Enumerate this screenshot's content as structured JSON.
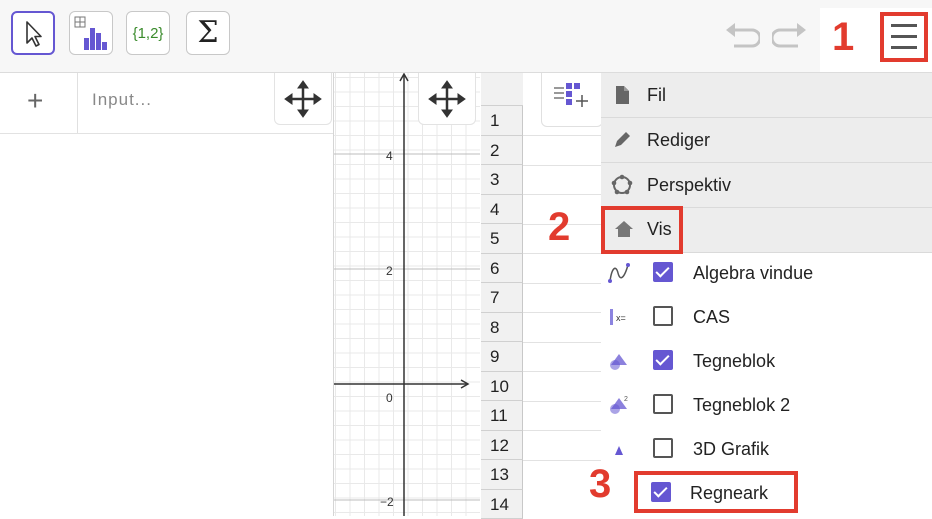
{
  "toolbar": {
    "tools": [
      {
        "name": "move-tool",
        "selected": true
      },
      {
        "name": "chart-tool",
        "selected": false
      },
      {
        "name": "list-tool",
        "label": "{1,2}",
        "selected": false
      },
      {
        "name": "sum-tool",
        "label": "Σ",
        "selected": false
      }
    ],
    "undo_icon": "undo-icon",
    "redo_icon": "redo-icon",
    "menu_icon": "hamburger-menu-icon"
  },
  "annotations": {
    "step1": "1",
    "step2": "2",
    "step3": "3",
    "highlight_color": "#e23b2e"
  },
  "algebra": {
    "add_symbol": "+",
    "input_placeholder": "Input..."
  },
  "graphics": {
    "y_labels": [
      "4",
      "2",
      "0",
      "−2"
    ]
  },
  "spreadsheet": {
    "row_numbers": [
      "1",
      "2",
      "3",
      "4",
      "5",
      "6",
      "7",
      "8",
      "9",
      "10",
      "11",
      "12",
      "13",
      "14"
    ]
  },
  "menu": {
    "items": [
      {
        "label": "Fil",
        "icon": "file-icon"
      },
      {
        "label": "Rediger",
        "icon": "pencil-icon"
      },
      {
        "label": "Perspektiv",
        "icon": "perspective-icon"
      },
      {
        "label": "Vis",
        "icon": "home-icon"
      }
    ],
    "view_options": [
      {
        "label": "Algebra vindue",
        "icon": "algebra-view-icon",
        "checked": true
      },
      {
        "label": "CAS",
        "icon": "cas-view-icon",
        "checked": false
      },
      {
        "label": "Tegneblok",
        "icon": "graphics-view-icon",
        "checked": true
      },
      {
        "label": "Tegneblok 2",
        "icon": "graphics2-view-icon",
        "checked": false
      },
      {
        "label": "3D Grafik",
        "icon": "3d-graphics-icon",
        "checked": false
      },
      {
        "label": "Regneark",
        "icon": "spreadsheet-view-icon",
        "checked": true
      }
    ],
    "accent_color": "#6557d2"
  }
}
